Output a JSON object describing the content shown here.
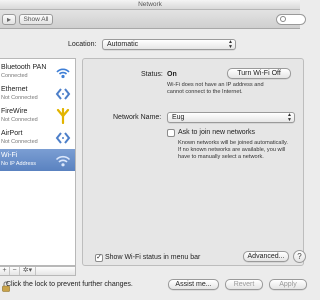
{
  "window": {
    "title": "Network"
  },
  "toolbar": {
    "nav_glyph": "▸",
    "show_all_label": "Show All",
    "search_placeholder": ""
  },
  "location": {
    "label": "Location:",
    "value": "Automatic"
  },
  "sidebar": {
    "items": [
      {
        "name": "Bluetooth PAN",
        "status": "Connected",
        "icon": "bluetooth-pan-icon",
        "selected": false
      },
      {
        "name": "Ethernet",
        "status": "Not Connected",
        "icon": "ethernet-icon",
        "selected": false
      },
      {
        "name": "FireWire",
        "status": "Not Connected",
        "icon": "firewire-icon",
        "selected": false
      },
      {
        "name": "AirPort",
        "status": "Not Connected",
        "icon": "airport-icon",
        "selected": false
      },
      {
        "name": "Wi-Fi",
        "status": "No IP Address",
        "icon": "wifi-icon",
        "selected": true
      }
    ],
    "controls": {
      "add": "+",
      "remove": "−",
      "actions": "✲▾"
    }
  },
  "detail": {
    "status_label": "Status:",
    "status_value": "On",
    "turn_wifi_off_label": "Turn Wi-Fi Off",
    "status_desc_line1": "Wi-Fi does not have an IP address and",
    "status_desc_line2": "cannot connect to the Internet.",
    "network_name_label": "Network Name:",
    "network_name_value": "Eug",
    "ask_join_label": "Ask to join new networks",
    "ask_join_checked": false,
    "ask_join_desc_line1": "Known networks will be joined automatically.",
    "ask_join_desc_line2": "If no known networks are available, you will",
    "ask_join_desc_line3": "have to manually select a network.",
    "show_status_label": "Show Wi-Fi status in menu bar",
    "show_status_checked": true,
    "advanced_label": "Advanced...",
    "help_label": "?"
  },
  "footer": {
    "lock_text": "Click the lock to prevent further changes.",
    "assist_label": "Assist me...",
    "revert_label": "Revert",
    "apply_label": "Apply"
  },
  "colors": {
    "selected_row": "#5a82c0",
    "wifi_blue": "#3f7fd6",
    "firewire_yellow": "#e2b400"
  }
}
